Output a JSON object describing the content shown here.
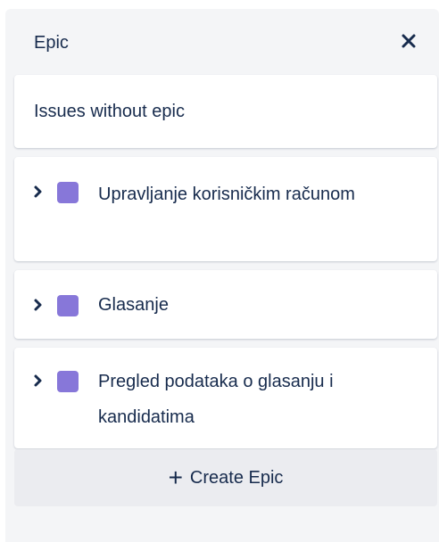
{
  "panel": {
    "title": "Epic",
    "close_icon": "close-icon",
    "issues_without_epic": "Issues without epic",
    "epics": [
      {
        "name": "Upravljanje korisničkim računom",
        "color": "#8777d9",
        "expand_icon": "chevron-right-icon"
      },
      {
        "name": "Glasanje",
        "color": "#8777d9",
        "expand_icon": "chevron-right-icon"
      },
      {
        "name": "Pregled podataka o glasanju i kandidatima",
        "color": "#8777d9",
        "expand_icon": "chevron-right-icon"
      }
    ],
    "create_icon": "plus-icon",
    "create_label": "Create Epic"
  },
  "colors": {
    "panel_bg": "#f4f5f7",
    "card_bg": "#ffffff",
    "text": "#172b4d",
    "epic_color": "#8777d9"
  }
}
